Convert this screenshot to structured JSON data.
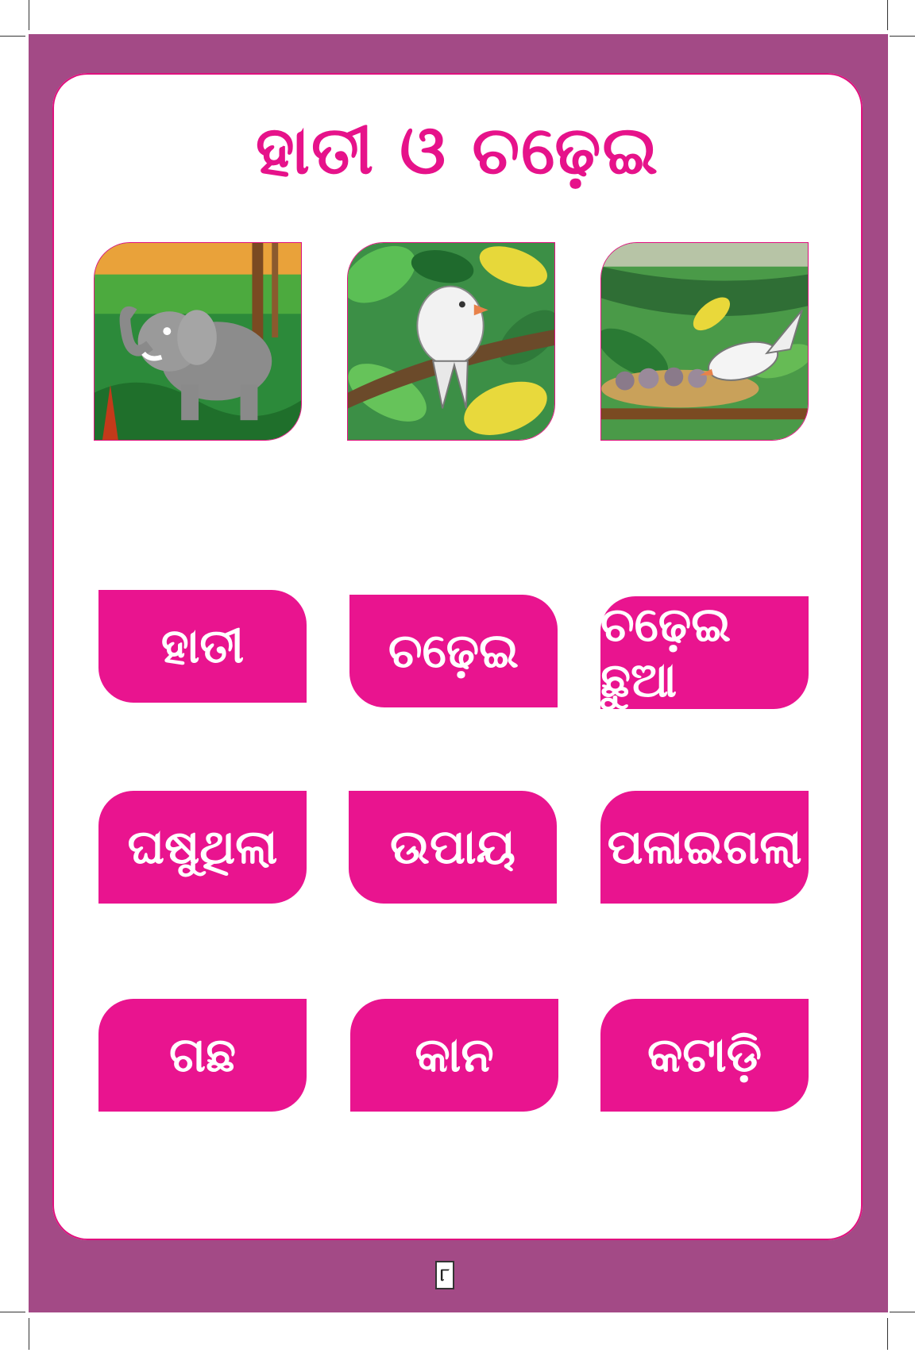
{
  "title": "ହାତୀ ଓ ଚଢ଼େଇ",
  "pictures": [
    {
      "icon": "elephant-icon"
    },
    {
      "icon": "bird-on-branch-icon"
    },
    {
      "icon": "bird-feeding-nest-icon"
    }
  ],
  "words": [
    "ହାତୀ",
    "ଚଢ଼େଇ",
    "ଚଢ଼େଇ ଛୁଆ",
    "ଘଷୁଥିଲା",
    "ଉପାୟ",
    "ପଳାଇଗଲା",
    "ଗଛ",
    "କାନ",
    "କଟାଡ଼ି"
  ],
  "page_number": "୮",
  "colors": {
    "frame": "#a34a86",
    "accent": "#e9148f",
    "title": "#e6128a"
  }
}
